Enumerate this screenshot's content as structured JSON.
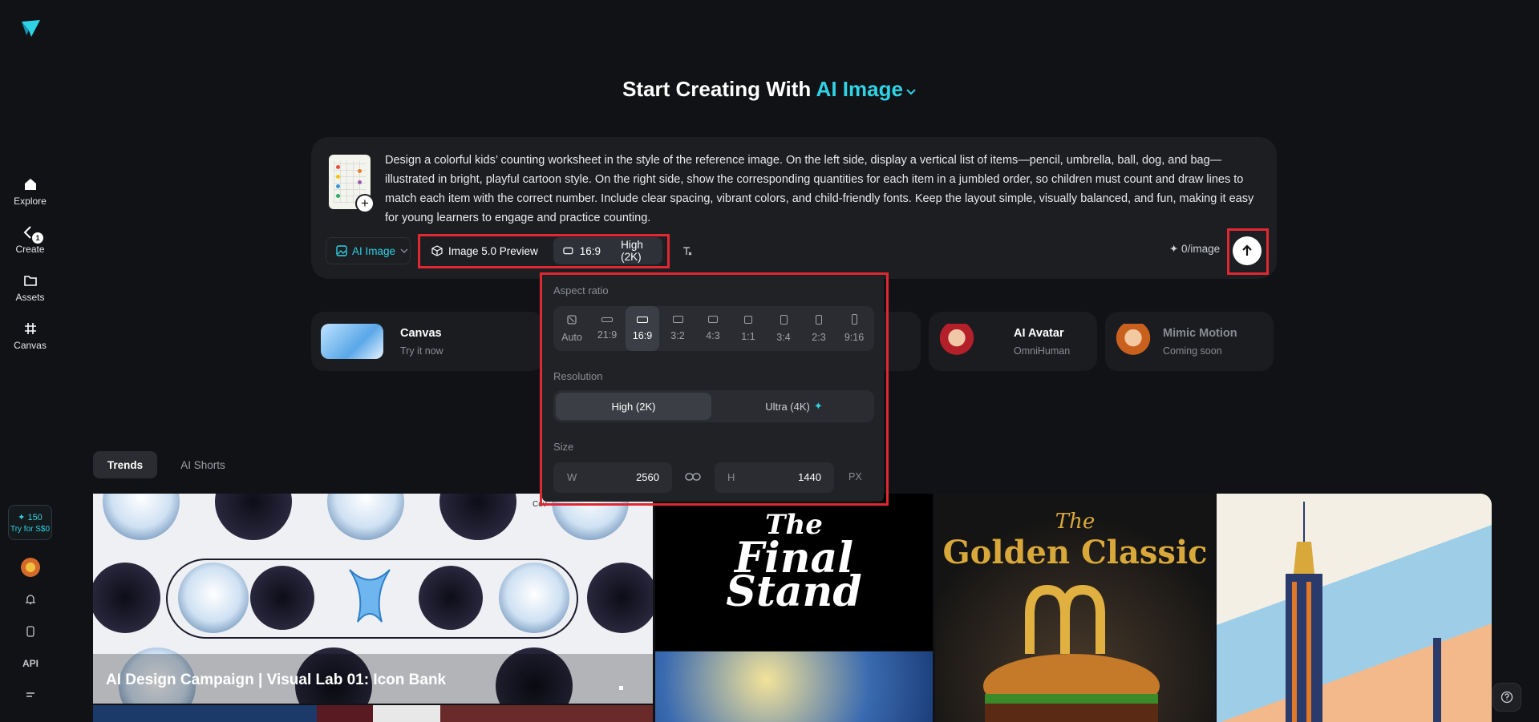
{
  "sidebar": {
    "logo_icon": "paper-plane-logo",
    "items": [
      {
        "label": "Explore",
        "icon": "home-icon"
      },
      {
        "label": "Create",
        "icon": "create-icon",
        "badge": "1"
      },
      {
        "label": "Assets",
        "icon": "folder-icon"
      },
      {
        "label": "Canvas",
        "icon": "canvas-icon"
      }
    ],
    "credits": {
      "amount": "✦ 150",
      "offer": "Try for S$0"
    },
    "api_label": "API"
  },
  "header": {
    "title_prefix": "Start Creating With",
    "title_accent": "AI Image",
    "accent_color": "#2fd3e6"
  },
  "prompt": {
    "text": "Design a colorful kids’ counting worksheet in the style of the reference image. On the left side, display a vertical list of items—pencil, umbrella, ball, dog, and bag—illustrated in bright, playful cartoon style. On the right side, show the corresponding quantities for each item in a jumbled order, so children must count and draw lines to match each item with the correct number. Include clear spacing, vibrant colors, and child-friendly fonts. Keep the layout simple, visually balanced, and fun, making it easy for young learners to engage and practice counting.",
    "add_label": "+"
  },
  "toolbar": {
    "mode_label": "AI Image",
    "model_label": "Image 5.0 Preview",
    "ratio_label": "16:9",
    "resolution_label": "High (2K)",
    "cost_label": "✦ 0/image"
  },
  "features": [
    {
      "title": "Canvas",
      "subtitle": "Try it now"
    },
    {
      "title": "AI Avatar",
      "subtitle": "OmniHuman"
    },
    {
      "title": "Mimic Motion",
      "subtitle": "Coming soon"
    }
  ],
  "popup": {
    "aspect_title": "Aspect ratio",
    "ratios": [
      "Auto",
      "21:9",
      "16:9",
      "3:2",
      "4:3",
      "1:1",
      "3:4",
      "2:3",
      "9:16"
    ],
    "selected_ratio": "16:9",
    "resolution_title": "Resolution",
    "resolutions": [
      "High (2K)",
      "Ultra (4K)"
    ],
    "selected_resolution": "High (2K)",
    "size_title": "Size",
    "width_label": "W",
    "width_value": "2560",
    "height_label": "H",
    "height_value": "1440",
    "unit": "PX"
  },
  "tabs": [
    {
      "label": "Trends",
      "active": true
    },
    {
      "label": "AI Shorts",
      "active": false
    }
  ],
  "gallery": {
    "featured_title": "AI Design Campaign | Visual Lab 01: Icon Bank",
    "tile2_title_line1": "The",
    "tile2_title_line2": "Final",
    "tile2_title_line3": "Stand",
    "tile3_title_line1": "The",
    "tile3_title_line2": "Golden Classic",
    "covered_text": "Cov"
  }
}
